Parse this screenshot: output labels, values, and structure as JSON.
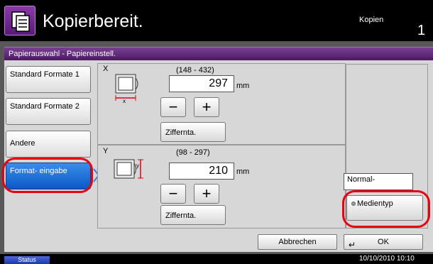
{
  "header": {
    "title": "Kopierbereit.",
    "job_label": "Kopien",
    "job_count": "1"
  },
  "dialog": {
    "title": "Papierauswahl - Papiereinstell."
  },
  "sidebar": {
    "items": [
      {
        "label": "Standard Formate 1"
      },
      {
        "label": "Standard Formate 2"
      },
      {
        "label": "Andere"
      },
      {
        "label": "Format- eingabe"
      }
    ]
  },
  "x_section": {
    "label": "X",
    "range": "(148 - 432)",
    "value": "297",
    "unit": "mm",
    "minus": "−",
    "plus": "+",
    "keypad": "Ziffernta."
  },
  "y_section": {
    "label": "Y",
    "range": "(98 - 297)",
    "value": "210",
    "unit": "mm",
    "minus": "−",
    "plus": "+",
    "keypad": "Ziffernta."
  },
  "media": {
    "value": "Normal-",
    "button_label": "Medientyp"
  },
  "footer": {
    "cancel": "Abbrechen",
    "ok": "OK"
  },
  "status_bar": {
    "status_label": "Status",
    "datetime": "10/10/2010  10:10"
  },
  "colors": {
    "accent": "#5a1a78",
    "active": "#0a58c8",
    "highlight": "#e60012"
  }
}
